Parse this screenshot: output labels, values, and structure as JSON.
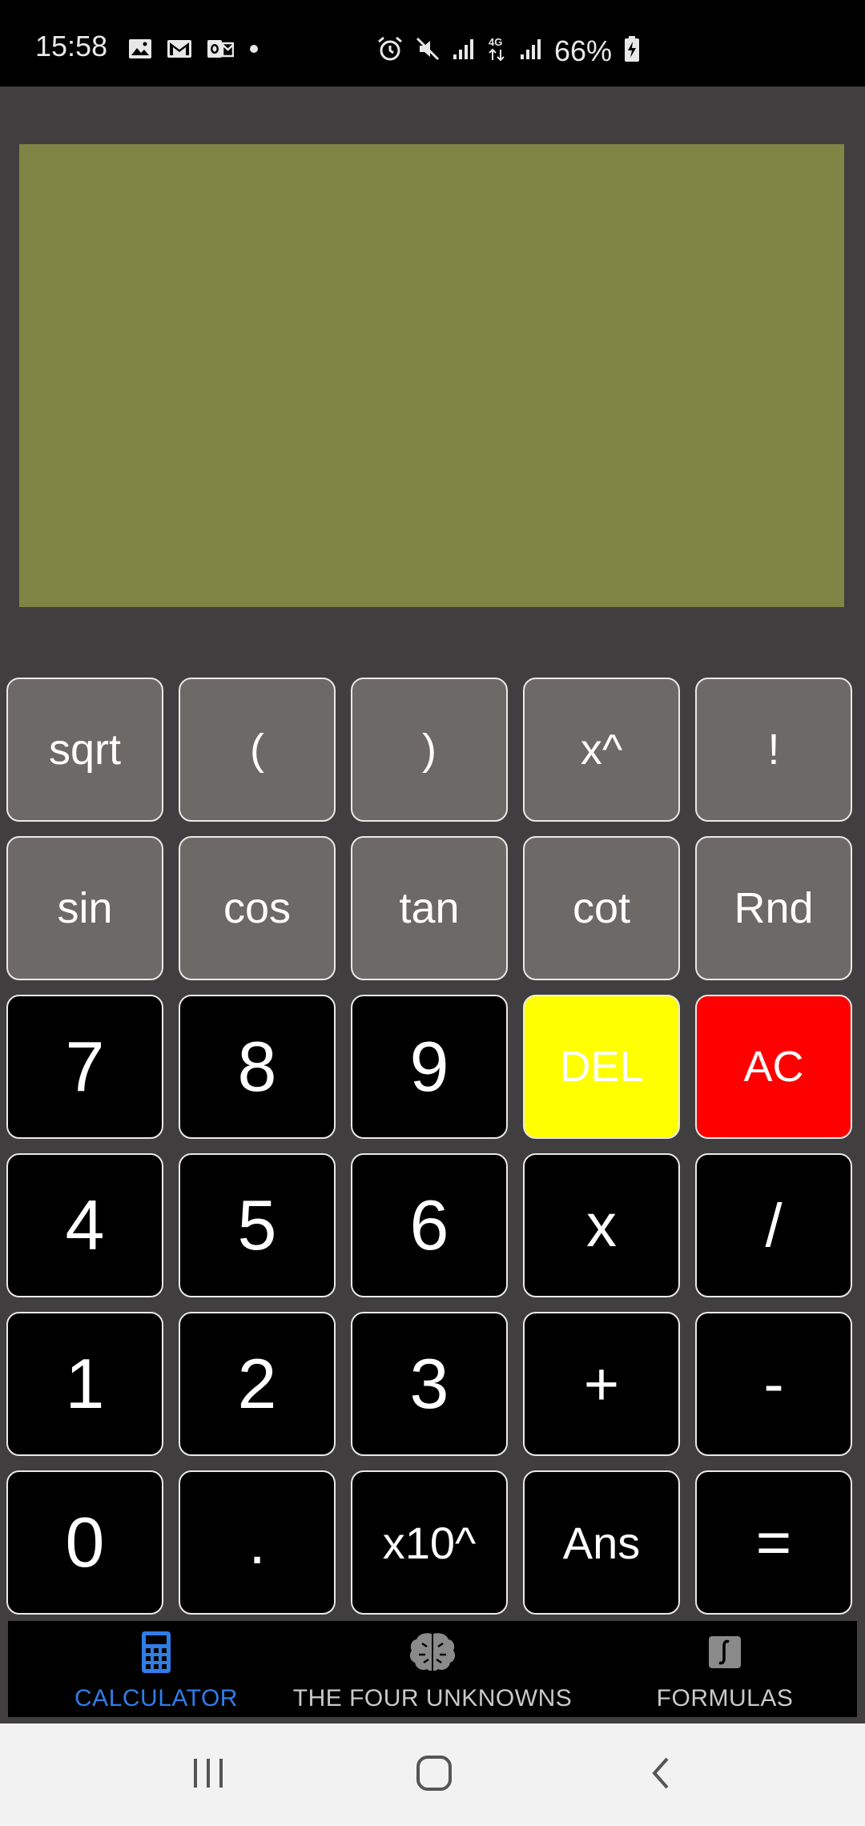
{
  "status_bar": {
    "time": "15:58",
    "left_icons": [
      "gallery-icon",
      "gmail-icon",
      "outlook-icon",
      "dot-icon"
    ],
    "right_icons": [
      "alarm-icon",
      "mute-icon",
      "signal-icon",
      "4g-icon",
      "signal-icon",
      "battery-charging-icon"
    ],
    "network": "4G",
    "battery": "66%"
  },
  "display": {
    "expression": "",
    "result": "",
    "background": "#808546"
  },
  "keypad": {
    "rows": [
      [
        "sqrt",
        "(",
        ")",
        "x^",
        "!"
      ],
      [
        "sin",
        "cos",
        "tan",
        "cot",
        "Rnd"
      ],
      [
        "7",
        "8",
        "9",
        "DEL",
        "AC"
      ],
      [
        "4",
        "5",
        "6",
        "x",
        "/"
      ],
      [
        "1",
        "2",
        "3",
        "+",
        "-"
      ],
      [
        "0",
        ".",
        "x10^",
        "Ans",
        "="
      ]
    ],
    "colors": {
      "function_key": "#6d6966",
      "number_key": "#000000",
      "del_key": "#ffff00",
      "ac_key": "#ff0000",
      "key_border": "#e9e9e9"
    }
  },
  "bottom_nav": {
    "items": [
      {
        "label": "CALCULATOR",
        "icon": "calculator-icon",
        "active": true
      },
      {
        "label": "THE FOUR UNKNOWNS",
        "icon": "brain-icon",
        "active": false
      },
      {
        "label": "FORMULAS",
        "icon": "integral-icon",
        "active": false
      }
    ],
    "active_color": "#2f7de9"
  },
  "system_nav": {
    "buttons": [
      "recent-apps-icon",
      "home-icon",
      "back-icon"
    ]
  }
}
